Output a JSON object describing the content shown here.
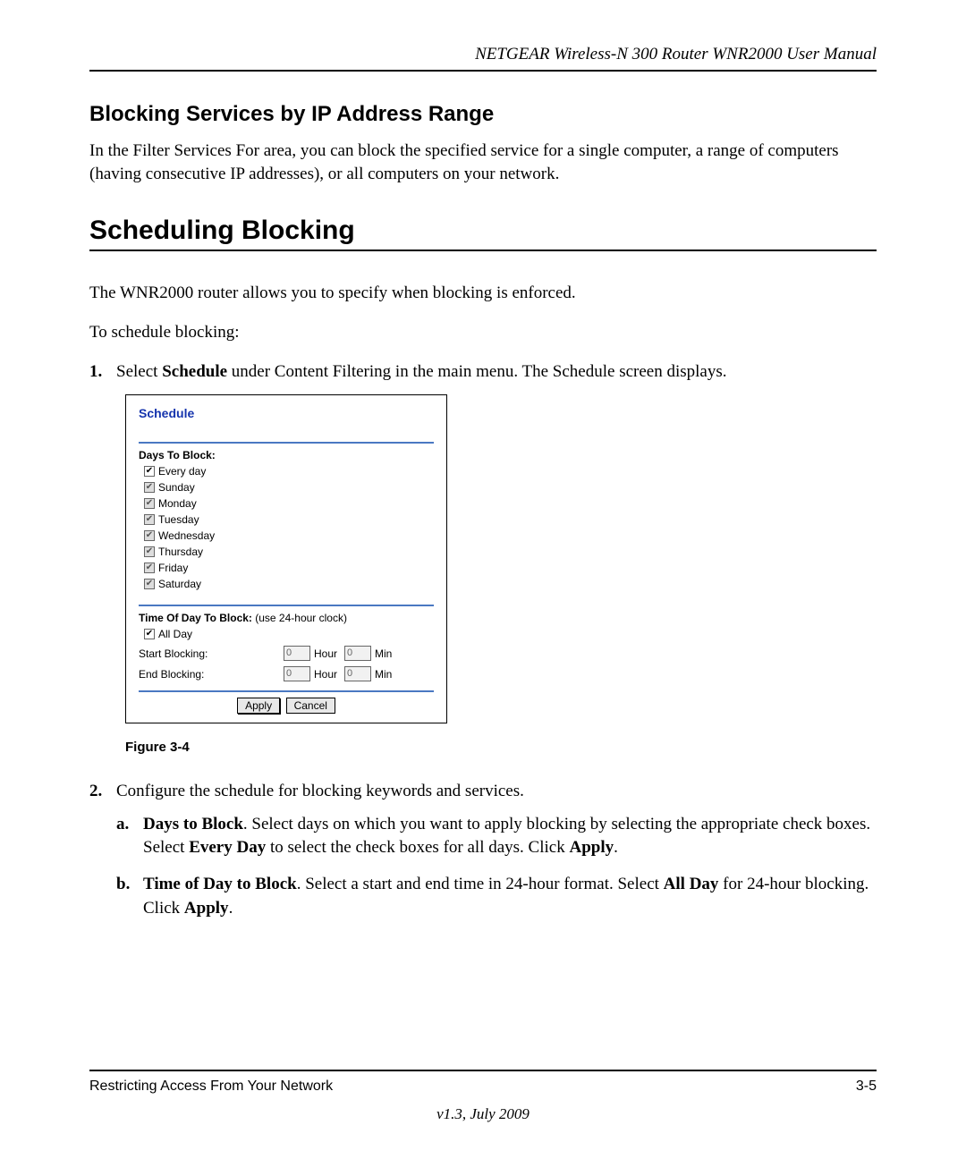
{
  "header": "NETGEAR Wireless-N 300 Router WNR2000 User Manual",
  "section1": {
    "heading": "Blocking Services by IP Address Range",
    "para": "In the Filter Services For area, you can block the specified service for a single computer, a range of computers (having consecutive IP addresses), or all computers on your network."
  },
  "section2": {
    "heading": "Scheduling Blocking",
    "para1": "The WNR2000 router allows you to specify when blocking is enforced.",
    "para2": "To schedule blocking:"
  },
  "step1": {
    "marker": "1.",
    "prefix": "Select ",
    "bold": "Schedule",
    "suffix": " under Content Filtering in the main menu. The Schedule screen displays."
  },
  "screenshot": {
    "title": "Schedule",
    "days_label": "Days To Block:",
    "days": [
      "Every day",
      "Sunday",
      "Monday",
      "Tuesday",
      "Wednesday",
      "Thursday",
      "Friday",
      "Saturday"
    ],
    "time_label": "Time Of Day To Block:",
    "time_hint": " (use 24-hour clock)",
    "allday": "All Day",
    "start_label": "Start Blocking:",
    "end_label": "End Blocking:",
    "hour_unit": "Hour",
    "min_unit": "Min",
    "value0": "0",
    "apply": "Apply",
    "cancel": "Cancel"
  },
  "figure_caption": "Figure 3-4",
  "step2": {
    "marker": "2.",
    "text": "Configure the schedule for blocking keywords and services."
  },
  "step2a": {
    "marker": "a.",
    "b1": "Days to Block",
    "t1": ". Select days on which you want to apply blocking by selecting the appropriate check boxes. Select ",
    "b2": "Every Day",
    "t2": " to select the check boxes for all days. Click ",
    "b3": "Apply",
    "t3": "."
  },
  "step2b": {
    "marker": "b.",
    "b1": "Time of Day to Block",
    "t1": ". Select a start and end time in 24-hour format. Select ",
    "b2": "All Day",
    "t2": " for 24-hour blocking. Click ",
    "b3": "Apply",
    "t3": "."
  },
  "footer": {
    "left": "Restricting Access From Your Network",
    "right": "3-5",
    "version": "v1.3, July 2009"
  }
}
